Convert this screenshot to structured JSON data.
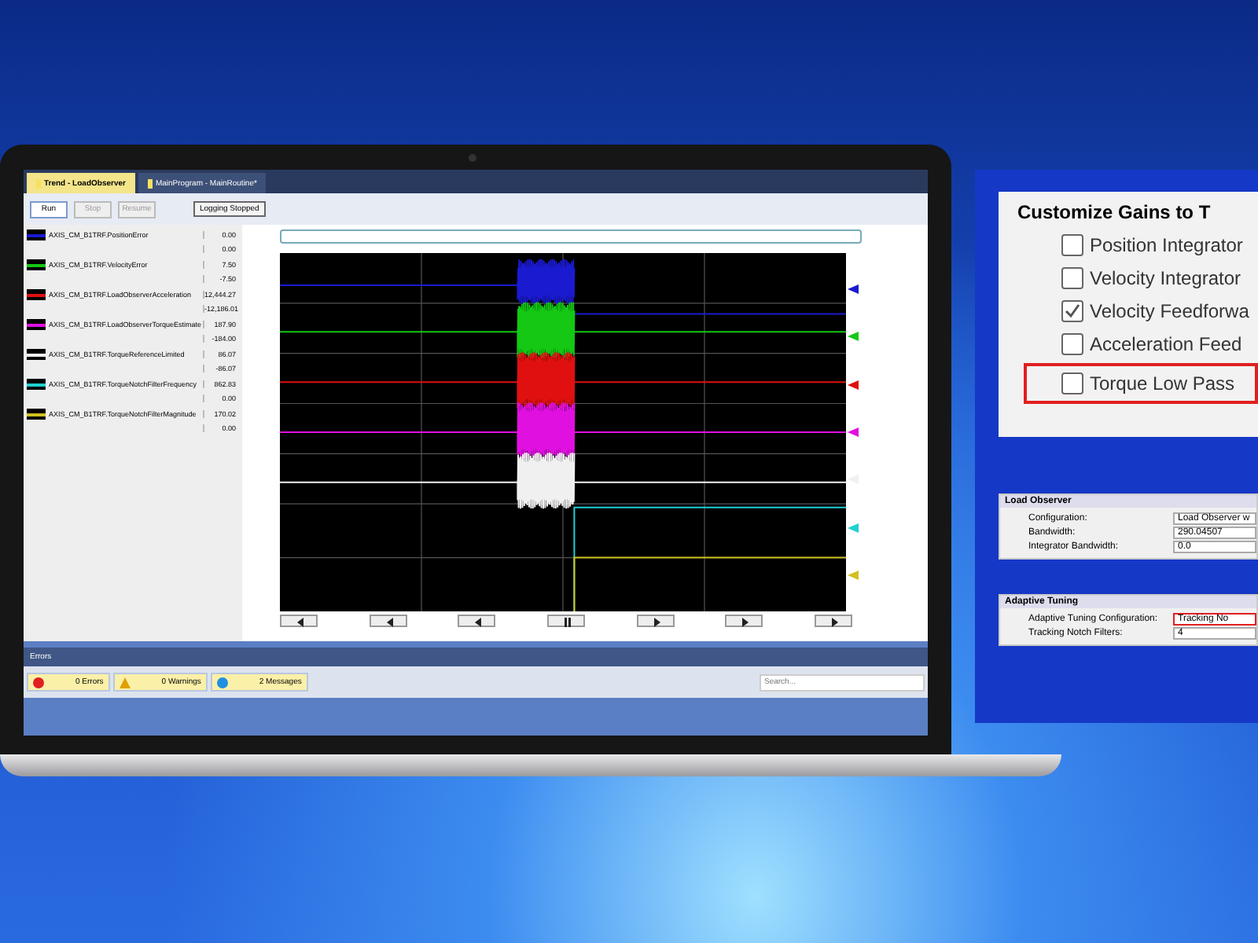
{
  "tabs": [
    {
      "label": "Trend - LoadObserver",
      "selected": true
    },
    {
      "label": "MainProgram - MainRoutine*",
      "selected": false
    }
  ],
  "toolbar": {
    "buttons": [
      {
        "label": "Run",
        "disabled": false
      },
      {
        "label": "Stop",
        "disabled": true
      },
      {
        "label": "Resume",
        "disabled": true
      }
    ],
    "status": "Logging Stopped"
  },
  "pens": [
    {
      "name": "AXIS_CM_B1TRF.PositionError",
      "color": "#1a1ad0",
      "max": "0.00",
      "min": "0.00"
    },
    {
      "name": "AXIS_CM_B1TRF.VelocityError",
      "color": "#14c814",
      "max": "7.50",
      "min": "-7.50"
    },
    {
      "name": "AXIS_CM_B1TRF.LoadObserverAcceleration",
      "color": "#e01010",
      "max": "12,444.27",
      "min": "-12,186.01"
    },
    {
      "name": "AXIS_CM_B1TRF.LoadObserverTorqueEstimate",
      "color": "#e010e0",
      "max": "187.90",
      "min": "-184.00"
    },
    {
      "name": "AXIS_CM_B1TRF.TorqueReferenceLimited",
      "color": "#f0f0f0",
      "max": "86.07",
      "min": "-86.07"
    },
    {
      "name": "AXIS_CM_B1TRF.TorqueNotchFilterFrequency",
      "color": "#20d0d0",
      "max": "862.83",
      "min": "0.00"
    },
    {
      "name": "AXIS_CM_B1TRF.TorqueNotchFilterMagnitude",
      "color": "#d0c020",
      "max": "170.02",
      "min": "0.00"
    }
  ],
  "errors": {
    "title": "Errors",
    "filters": [
      {
        "kind": "error",
        "label": "0 Errors"
      },
      {
        "kind": "warning",
        "label": "0 Warnings"
      },
      {
        "kind": "message",
        "label": "2 Messages"
      }
    ],
    "search": {
      "placeholder": "Search..."
    }
  },
  "gains_panel": {
    "title": "Customize Gains to T",
    "options": [
      {
        "label": "Position Integrator",
        "checked": false,
        "highlighted": false
      },
      {
        "label": "Velocity Integrator",
        "checked": false,
        "highlighted": false
      },
      {
        "label": "Velocity Feedforwa",
        "checked": true,
        "highlighted": false
      },
      {
        "label": "Acceleration Feed",
        "checked": false,
        "highlighted": false
      },
      {
        "label": "Torque Low Pass",
        "checked": false,
        "highlighted": true
      }
    ]
  },
  "load_observer": {
    "title": "Load Observer",
    "fields": [
      {
        "label": "Configuration:",
        "value": "Load Observer w",
        "highlighted": false
      },
      {
        "label": "Bandwidth:",
        "value": "290.04507",
        "highlighted": false
      },
      {
        "label": "Integrator Bandwidth:",
        "value": "0.0",
        "highlighted": false
      }
    ]
  },
  "adaptive_tuning": {
    "title": "Adaptive Tuning",
    "fields": [
      {
        "label": "Adaptive Tuning Configuration:",
        "value": "Tracking No",
        "highlighted": true
      },
      {
        "label": "Tracking Notch Filters:",
        "value": "4",
        "highlighted": false
      }
    ]
  }
}
